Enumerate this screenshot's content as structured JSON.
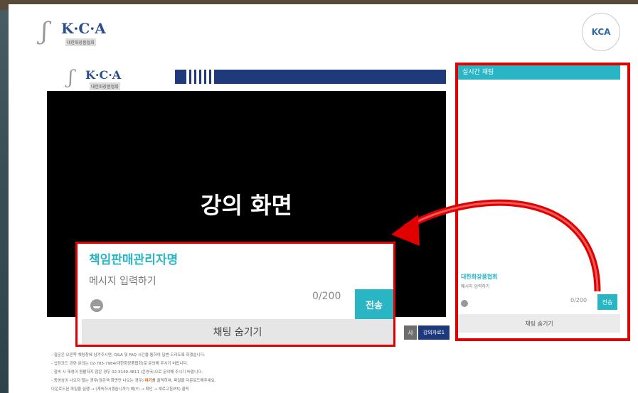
{
  "brand": {
    "logo_text": "K·C·A",
    "logo_sub": "대한화장품협회",
    "seal_text": "KCA"
  },
  "video": {
    "title": "강의 화면"
  },
  "chat_small": {
    "header": "실시간 채팅",
    "name": "대한화장품협회",
    "placeholder": "메시지 입력하기",
    "count": "0/200",
    "send": "전송",
    "hide": "채팅 숨기기"
  },
  "chat_zoom": {
    "name": "책임판매관리자명",
    "placeholder": "메시지 입력하기",
    "count": "0/200",
    "send": "전송",
    "hide": "채팅 숨기기"
  },
  "tabs": {
    "a": "사",
    "b": "강의자료1"
  },
  "notes": [
    "- 질문은 오른쪽 채팅창에 남겨주시면, Q&A 및 FAQ 시간을 통하여 답변 드리도록 하겠습니다.",
    "- 입장코드 관련 문의는 02-785-7984(대한화장품협회)로 문의해 주시기 바랍니다.",
    "- 접속 시 재생이 원활하지 않은 경우 02-3149-4811 (운영국)으로 문의해 주시기 바랍니다.",
    "- 동영상이 나오지 않는 경우(검은색 화면만 나오는 경우) 여기를 클릭하여, 파일을 다운로드해주세요.",
    "  다운로드된 파일을 실행 → (계속하시겠습니까?) 예(Y) → 확인 → 새로고침(F5) 클릭"
  ],
  "notes_highlight": "여기",
  "colors": {
    "accent": "#2ab5c4",
    "navy": "#1e3a7a",
    "annotation": "#e00000"
  }
}
